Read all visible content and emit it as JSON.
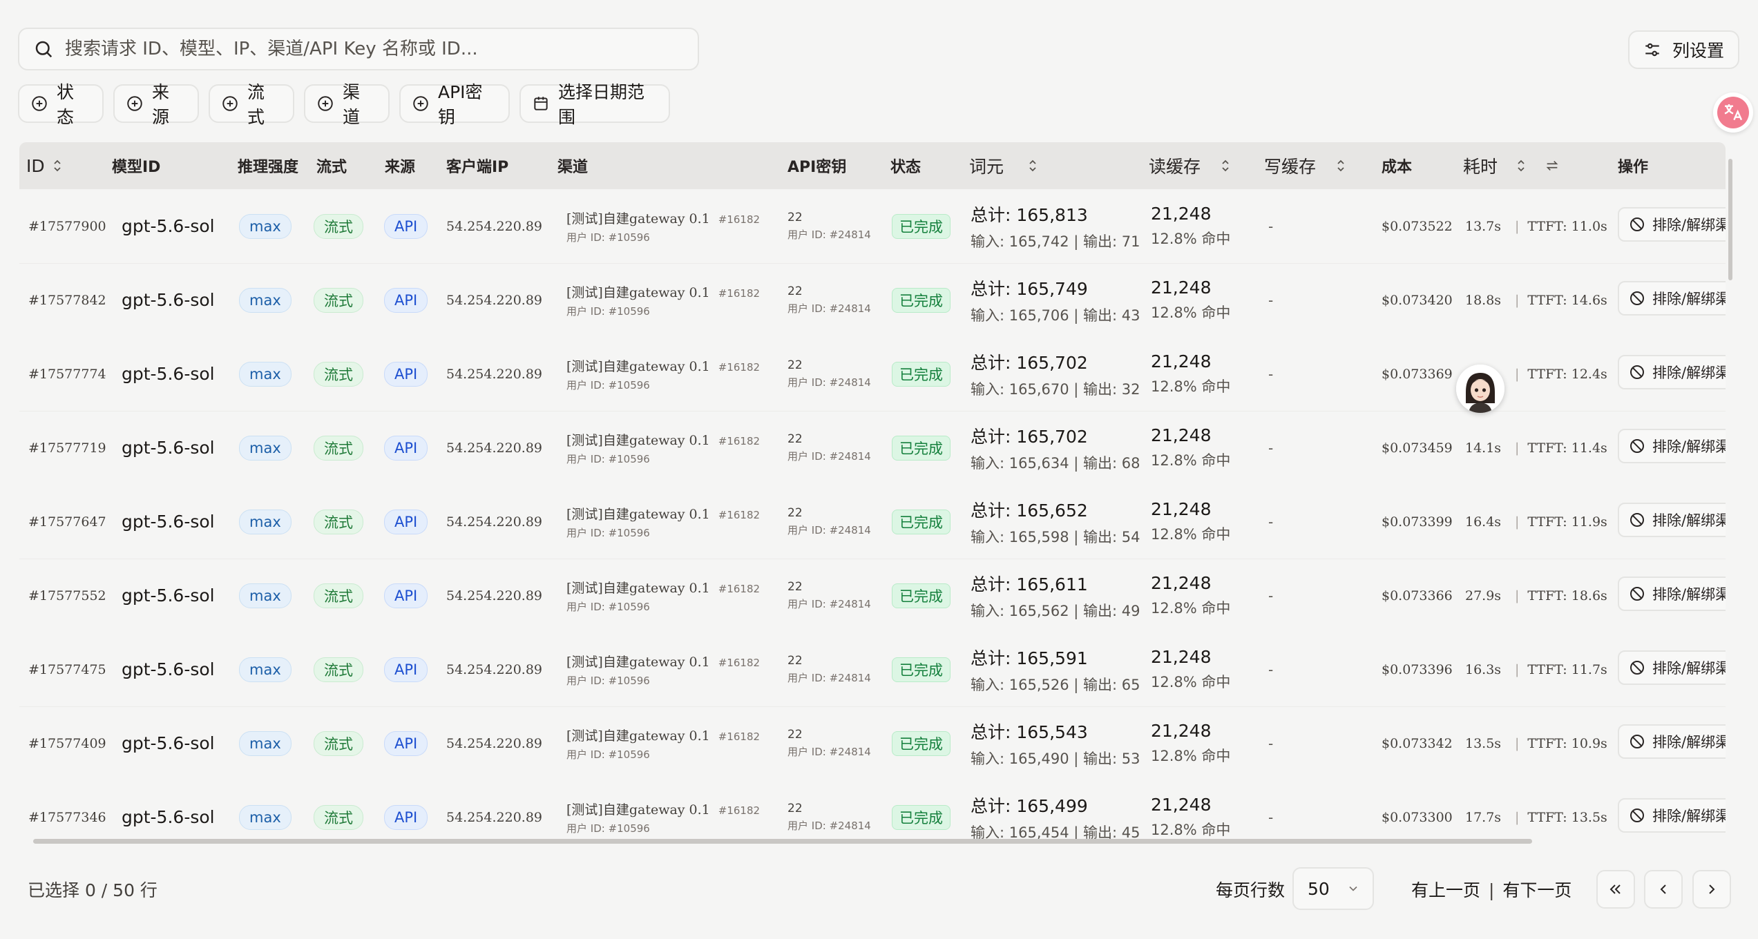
{
  "search": {
    "placeholder": "搜索请求 ID、模型、IP、渠道/API Key 名称或 ID..."
  },
  "toolbar": {
    "column_settings": "列设置"
  },
  "filters": [
    "状态",
    "来源",
    "流式",
    "渠道",
    "API密钥",
    "选择日期范围"
  ],
  "columns": {
    "id": "ID",
    "model": "模型ID",
    "reasoning": "推理强度",
    "stream": "流式",
    "source": "来源",
    "client_ip": "客户端IP",
    "channel": "渠道",
    "api_key": "API密钥",
    "status": "状态",
    "tokens": "词元",
    "read_cache": "读缓存",
    "write_cache": "写缓存",
    "cost": "成本",
    "latency": "耗时",
    "actions": "操作"
  },
  "rows": [
    {
      "id": "#17577900",
      "model": "gpt-5.6-sol",
      "reasoning": "max",
      "stream": "流式",
      "source": "API",
      "ip": "54.254.220.89",
      "channel": "[测试]自建gateway 0.1",
      "channel_num": "#16182",
      "channel_user": "用户 ID: #10596",
      "key": "22",
      "key_user": "用户 ID: #24814",
      "status": "已完成",
      "tokens_total": "总计: 165,813",
      "tokens_io": "输入: 165,742 | 输出: 71",
      "cache_read": "21,248",
      "cache_hit": "12.8% 命中",
      "cache_write": "-",
      "cost": "$0.073522",
      "latency": "13.7s",
      "ttft": "TTFT: 11.0s",
      "action": "排除/解绑渠道"
    },
    {
      "id": "#17577842",
      "model": "gpt-5.6-sol",
      "reasoning": "max",
      "stream": "流式",
      "source": "API",
      "ip": "54.254.220.89",
      "channel": "[测试]自建gateway 0.1",
      "channel_num": "#16182",
      "channel_user": "用户 ID: #10596",
      "key": "22",
      "key_user": "用户 ID: #24814",
      "status": "已完成",
      "tokens_total": "总计: 165,749",
      "tokens_io": "输入: 165,706 | 输出: 43",
      "cache_read": "21,248",
      "cache_hit": "12.8% 命中",
      "cache_write": "-",
      "cost": "$0.073420",
      "latency": "18.8s",
      "ttft": "TTFT: 14.6s",
      "action": "排除/解绑渠道"
    },
    {
      "id": "#17577774",
      "model": "gpt-5.6-sol",
      "reasoning": "max",
      "stream": "流式",
      "source": "API",
      "ip": "54.254.220.89",
      "channel": "[测试]自建gateway 0.1",
      "channel_num": "#16182",
      "channel_user": "用户 ID: #10596",
      "key": "22",
      "key_user": "用户 ID: #24814",
      "status": "已完成",
      "tokens_total": "总计: 165,702",
      "tokens_io": "输入: 165,670 | 输出: 32",
      "cache_read": "21,248",
      "cache_hit": "12.8% 命中",
      "cache_write": "-",
      "cost": "$0.073369",
      "latency": "",
      "ttft": "TTFT: 12.4s",
      "action": "排除/解绑渠道"
    },
    {
      "id": "#17577719",
      "model": "gpt-5.6-sol",
      "reasoning": "max",
      "stream": "流式",
      "source": "API",
      "ip": "54.254.220.89",
      "channel": "[测试]自建gateway 0.1",
      "channel_num": "#16182",
      "channel_user": "用户 ID: #10596",
      "key": "22",
      "key_user": "用户 ID: #24814",
      "status": "已完成",
      "tokens_total": "总计: 165,702",
      "tokens_io": "输入: 165,634 | 输出: 68",
      "cache_read": "21,248",
      "cache_hit": "12.8% 命中",
      "cache_write": "-",
      "cost": "$0.073459",
      "latency": "14.1s",
      "ttft": "TTFT: 11.4s",
      "action": "排除/解绑渠道"
    },
    {
      "id": "#17577647",
      "model": "gpt-5.6-sol",
      "reasoning": "max",
      "stream": "流式",
      "source": "API",
      "ip": "54.254.220.89",
      "channel": "[测试]自建gateway 0.1",
      "channel_num": "#16182",
      "channel_user": "用户 ID: #10596",
      "key": "22",
      "key_user": "用户 ID: #24814",
      "status": "已完成",
      "tokens_total": "总计: 165,652",
      "tokens_io": "输入: 165,598 | 输出: 54",
      "cache_read": "21,248",
      "cache_hit": "12.8% 命中",
      "cache_write": "-",
      "cost": "$0.073399",
      "latency": "16.4s",
      "ttft": "TTFT: 11.9s",
      "action": "排除/解绑渠道"
    },
    {
      "id": "#17577552",
      "model": "gpt-5.6-sol",
      "reasoning": "max",
      "stream": "流式",
      "source": "API",
      "ip": "54.254.220.89",
      "channel": "[测试]自建gateway 0.1",
      "channel_num": "#16182",
      "channel_user": "用户 ID: #10596",
      "key": "22",
      "key_user": "用户 ID: #24814",
      "status": "已完成",
      "tokens_total": "总计: 165,611",
      "tokens_io": "输入: 165,562 | 输出: 49",
      "cache_read": "21,248",
      "cache_hit": "12.8% 命中",
      "cache_write": "-",
      "cost": "$0.073366",
      "latency": "27.9s",
      "ttft": "TTFT: 18.6s",
      "action": "排除/解绑渠道"
    },
    {
      "id": "#17577475",
      "model": "gpt-5.6-sol",
      "reasoning": "max",
      "stream": "流式",
      "source": "API",
      "ip": "54.254.220.89",
      "channel": "[测试]自建gateway 0.1",
      "channel_num": "#16182",
      "channel_user": "用户 ID: #10596",
      "key": "22",
      "key_user": "用户 ID: #24814",
      "status": "已完成",
      "tokens_total": "总计: 165,591",
      "tokens_io": "输入: 165,526 | 输出: 65",
      "cache_read": "21,248",
      "cache_hit": "12.8% 命中",
      "cache_write": "-",
      "cost": "$0.073396",
      "latency": "16.3s",
      "ttft": "TTFT: 11.7s",
      "action": "排除/解绑渠道"
    },
    {
      "id": "#17577409",
      "model": "gpt-5.6-sol",
      "reasoning": "max",
      "stream": "流式",
      "source": "API",
      "ip": "54.254.220.89",
      "channel": "[测试]自建gateway 0.1",
      "channel_num": "#16182",
      "channel_user": "用户 ID: #10596",
      "key": "22",
      "key_user": "用户 ID: #24814",
      "status": "已完成",
      "tokens_total": "总计: 165,543",
      "tokens_io": "输入: 165,490 | 输出: 53",
      "cache_read": "21,248",
      "cache_hit": "12.8% 命中",
      "cache_write": "-",
      "cost": "$0.073342",
      "latency": "13.5s",
      "ttft": "TTFT: 10.9s",
      "action": "排除/解绑渠道"
    },
    {
      "id": "#17577346",
      "model": "gpt-5.6-sol",
      "reasoning": "max",
      "stream": "流式",
      "source": "API",
      "ip": "54.254.220.89",
      "channel": "[测试]自建gateway 0.1",
      "channel_num": "#16182",
      "channel_user": "用户 ID: #10596",
      "key": "22",
      "key_user": "用户 ID: #24814",
      "status": "已完成",
      "tokens_total": "总计: 165,499",
      "tokens_io": "输入: 165,454 | 输出: 45",
      "cache_read": "21,248",
      "cache_hit": "12.8% 命中",
      "cache_write": "-",
      "cost": "$0.073300",
      "latency": "17.7s",
      "ttft": "TTFT: 13.5s",
      "action": "排除/解绑渠道"
    }
  ],
  "footer": {
    "selected": "已选择 0 / 50 行",
    "rows_per_page_label": "每页行数",
    "rows_per_page": "50",
    "prev": "有上一页",
    "separator": "|",
    "next": "有下一页"
  },
  "colors": {
    "accent_pink": "#f17b8e",
    "success_green": "#15803d",
    "api_blue": "#1d4fd0"
  },
  "icons": [
    "search-icon",
    "sliders-icon",
    "plus-circle-icon",
    "calendar-icon",
    "translate-icon",
    "sort-icon",
    "swap-icon",
    "ban-icon",
    "chevron-down-icon",
    "chevrons-left-icon",
    "chevron-left-icon",
    "chevron-right-icon",
    "avatar"
  ]
}
